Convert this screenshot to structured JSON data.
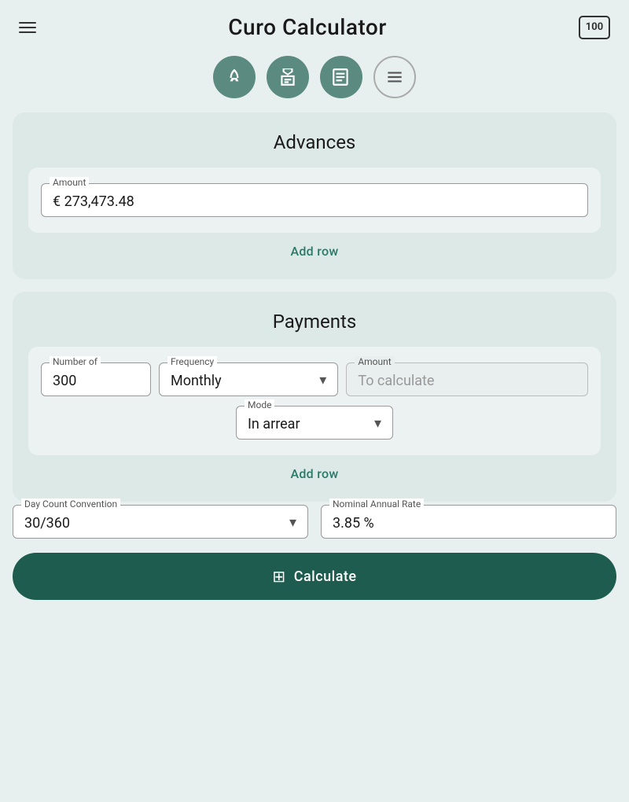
{
  "header": {
    "menu_label": "menu",
    "title": "Curo Calculator",
    "money_icon": "100"
  },
  "nav": {
    "items": [
      {
        "id": "rocket",
        "icon": "rocket",
        "active": true
      },
      {
        "id": "badge",
        "icon": "badge",
        "active": true
      },
      {
        "id": "book",
        "icon": "book",
        "active": true
      },
      {
        "id": "list",
        "icon": "list",
        "active": false
      }
    ]
  },
  "advances": {
    "title": "Advances",
    "amount_label": "Amount",
    "amount_value": "€ 273,473.48",
    "add_row_label": "Add row"
  },
  "payments": {
    "title": "Payments",
    "number_label": "Number of",
    "number_value": "300",
    "frequency_label": "Frequency",
    "frequency_value": "Monthly",
    "amount_label": "Amount",
    "amount_placeholder": "To calculate",
    "mode_label": "Mode",
    "mode_value": "In arrear",
    "add_row_label": "Add row"
  },
  "day_count": {
    "label": "Day Count Convention",
    "value": "30/360"
  },
  "nominal_rate": {
    "label": "Nominal Annual Rate",
    "value": "3.85 %"
  },
  "calculate_button": {
    "label": "Calculate",
    "icon": "calculator"
  }
}
